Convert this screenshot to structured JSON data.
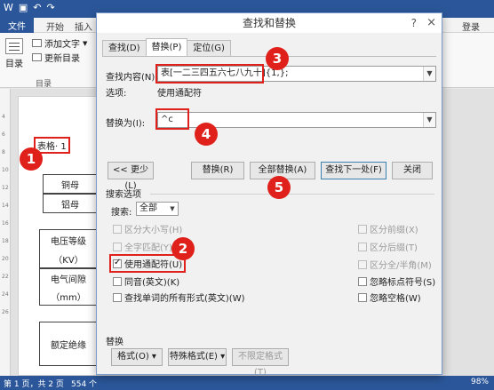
{
  "word": {
    "file_tab": "文件",
    "tabs": [
      "开始",
      "插入"
    ],
    "login": "登录",
    "ribbon": {
      "toc_label": "目录",
      "add_text": "添加文字",
      "update_toc": "更新目录",
      "group_label": "目录"
    },
    "ruler_numbers": [
      "4",
      "6",
      "8",
      "10",
      "12",
      "14",
      "16",
      "18",
      "20",
      "22",
      "24",
      "26"
    ],
    "doc": {
      "caption": "表格· 1",
      "cells": [
        "铜母",
        "铝母",
        "电压等级",
        "（KV）",
        "电气间隙",
        "（mm）",
        "额定绝缘"
      ]
    },
    "status": {
      "page": "第 1 页，共 2 页",
      "words": "554 个",
      "zoom": "98%"
    }
  },
  "dialog": {
    "title": "查找和替换",
    "help": "?",
    "close": "×",
    "tabs": [
      "查找(D)",
      "替换(P)",
      "定位(G)"
    ],
    "find_label": "查找内容(N):",
    "find_value": "表[一二三四五六七八九十]{1,};",
    "options_label": "选项:",
    "options_value": "使用通配符",
    "replace_label": "替换为(I):",
    "replace_value": "^c",
    "buttons": {
      "less": "<< 更少(L)",
      "replace": "替换(R)",
      "replace_all": "全部替换(A)",
      "find_next": "查找下一处(F)",
      "close": "关闭"
    },
    "search_options_title": "搜索选项",
    "search_label": "搜索:",
    "search_value": "全部",
    "left_options": [
      {
        "label": "区分大小写(H)",
        "checked": false,
        "disabled": true
      },
      {
        "label": "全字匹配(Y)",
        "checked": false,
        "disabled": true
      },
      {
        "label": "使用通配符(U)",
        "checked": true,
        "disabled": false
      },
      {
        "label": "同音(英文)(K)",
        "checked": false,
        "disabled": false
      },
      {
        "label": "查找单词的所有形式(英文)(W)",
        "checked": false,
        "disabled": false
      }
    ],
    "right_options": [
      {
        "label": "区分前缀(X)",
        "checked": false,
        "disabled": true
      },
      {
        "label": "区分后缀(T)",
        "checked": false,
        "disabled": true
      },
      {
        "label": "区分全/半角(M)",
        "checked": false,
        "disabled": true
      },
      {
        "label": "忽略标点符号(S)",
        "checked": false,
        "disabled": false
      },
      {
        "label": "忽略空格(W)",
        "checked": false,
        "disabled": false
      }
    ],
    "replace_section_title": "替换",
    "bottom_buttons": {
      "format": "格式(O) ▾",
      "special": "特殊格式(E) ▾",
      "no_format": "不限定格式(T)"
    }
  },
  "annotations": [
    "1",
    "2",
    "3",
    "4",
    "5"
  ],
  "colors": {
    "annotation_red": "#e0201a",
    "word_blue": "#2b579a"
  }
}
